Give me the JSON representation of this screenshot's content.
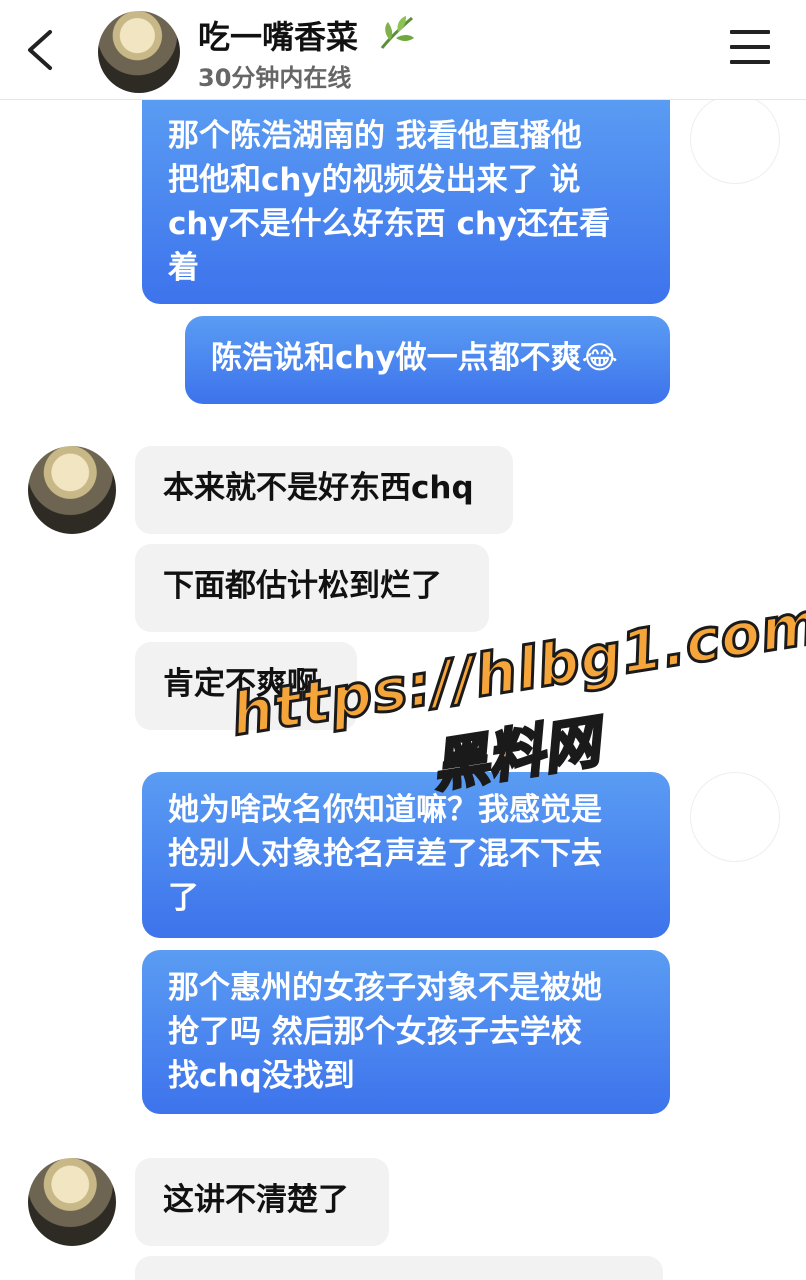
{
  "header": {
    "back_icon": "chevron-left-icon",
    "contact_name": "吃一嘴香菜",
    "name_icon": "herb-leaf-icon",
    "status": "30分钟内在线",
    "menu_icon": "hamburger-menu-icon"
  },
  "messages": [
    {
      "side": "sent",
      "lines": [
        "那个陈浩湖南的 我看他直播他",
        "把他和chy的视频发出来了 说",
        "chy不是什么好东西 chy还在看",
        "着"
      ]
    },
    {
      "side": "sent",
      "lines": [
        "陈浩说和chy做一点都不爽"
      ],
      "emoji": "😂"
    },
    {
      "side": "received",
      "lines": [
        "本来就不是好东西chq"
      ]
    },
    {
      "side": "received",
      "lines": [
        "下面都估计松到烂了"
      ]
    },
    {
      "side": "received",
      "lines": [
        "肯定不爽啊"
      ]
    },
    {
      "side": "sent",
      "lines": [
        "她为啥改名你知道嘛？我感觉是",
        "抢别人对象抢名声差了混不下去",
        "了"
      ]
    },
    {
      "side": "sent",
      "lines": [
        "那个惠州的女孩子对象不是被她",
        "抢了吗 然后那个女孩子去学校",
        "找chq没找到"
      ]
    },
    {
      "side": "received",
      "lines": [
        "这讲不清楚了"
      ]
    }
  ],
  "watermark": {
    "url": "https://hlbg1.com",
    "text": "黑料网"
  },
  "colors": {
    "sent_bubble_top": "#5a9cf3",
    "sent_bubble_bottom": "#3d73ec",
    "received_bubble": "#f2f2f2",
    "watermark_fill": "#f5a53a"
  }
}
